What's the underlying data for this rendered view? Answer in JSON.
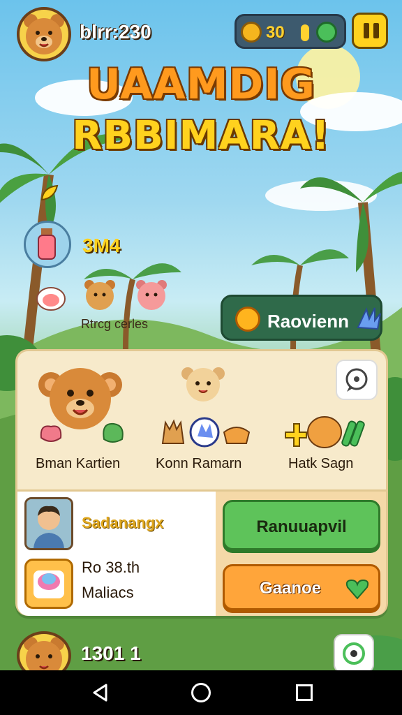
{
  "header": {
    "player_name": "blrr:230",
    "coins": "30",
    "accent_color": "#ffd21e"
  },
  "title": {
    "line1": "UAAMDIG",
    "line2": "RBBIMARA!"
  },
  "side": {
    "score": "3M4",
    "friends_label": "Rtrcg cerles",
    "random_button_label": "Raovienn"
  },
  "panel": {
    "characters": [
      {
        "label": "Bman Kartien"
      },
      {
        "label": "Konn Ramarn"
      },
      {
        "label": "Hatk Sagn"
      }
    ],
    "profile_name": "Sadanangx",
    "stat1": "Ro 38.th",
    "stat2": "Maliacs",
    "green_button_label": "Ranuuapvil",
    "orange_button_label": "Gaanoe"
  },
  "bottom": {
    "score": "1301 1"
  },
  "icons": [
    "coin-icon",
    "gem-icon",
    "pause-icon",
    "potion-icon",
    "sun-icon",
    "hand-icon",
    "chat-icon",
    "heart-icon",
    "back-icon",
    "home-icon",
    "recent-icon"
  ]
}
